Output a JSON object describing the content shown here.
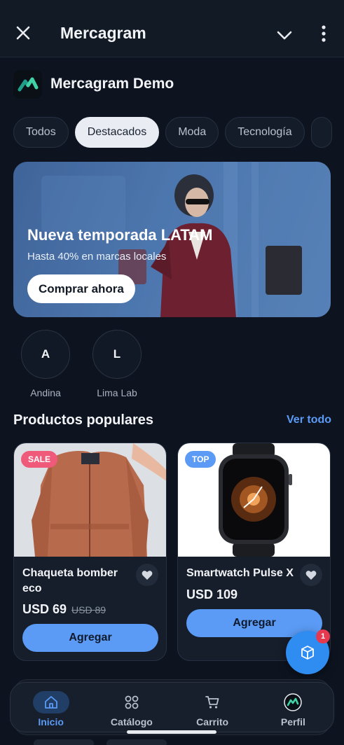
{
  "app_bar": {
    "title": "Mercagram",
    "close_icon": "close-icon",
    "collapse_icon": "chevron-down-icon",
    "menu_icon": "more-vertical-icon"
  },
  "store": {
    "name": "Mercagram Demo"
  },
  "categories": {
    "items": [
      "Todos",
      "Destacados",
      "Moda",
      "Tecnología"
    ],
    "selected": "Destacados"
  },
  "banner": {
    "title": "Nueva temporada LATAM",
    "subtitle": "Hasta 40% en marcas locales",
    "cta": "Comprar ahora"
  },
  "brands": [
    {
      "initial": "A",
      "name": "Andina"
    },
    {
      "initial": "L",
      "name": "Lima Lab"
    }
  ],
  "popular": {
    "title": "Productos populares",
    "see_all": "Ver todo",
    "products": [
      {
        "tag": "SALE",
        "name": "Chaqueta bomber eco",
        "price": "USD 69",
        "old_price": "USD 89",
        "button": "Agregar"
      },
      {
        "tag": "TOP",
        "name": "Smartwatch Pulse X",
        "price": "USD 109",
        "button": "Agregar"
      }
    ]
  },
  "cart_fab": {
    "icon": "package-icon",
    "badge": "1"
  },
  "bottom_nav": {
    "items": [
      {
        "label": "Inicio",
        "icon": "home-icon",
        "active": true
      },
      {
        "label": "Catálogo",
        "icon": "grid-icon",
        "active": false
      },
      {
        "label": "Carrito",
        "icon": "cart-icon",
        "active": false
      },
      {
        "label": "Perfil",
        "icon": "avatar-icon",
        "active": false
      }
    ]
  },
  "colors": {
    "background": "#0d1420",
    "accent": "#5b9bf5",
    "sale_tag": "#f05a7a",
    "top_tag": "#5b9bf5",
    "badge": "#e53950"
  }
}
